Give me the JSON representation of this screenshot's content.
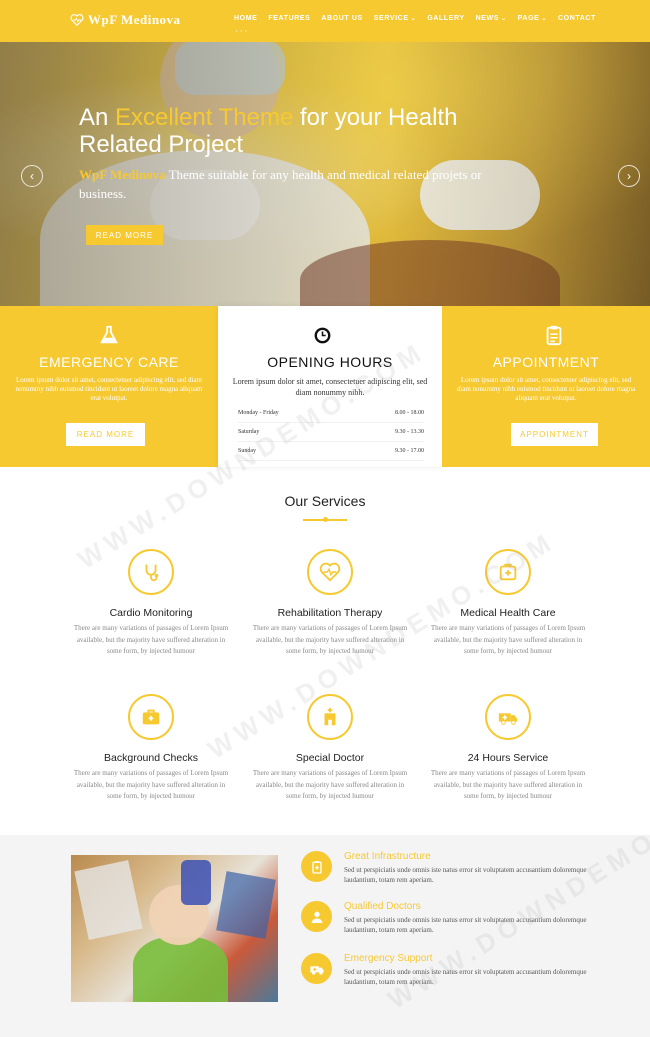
{
  "nav": {
    "logo": "WpF Medinova",
    "items": [
      {
        "label": "HOME",
        "has_caret": false,
        "active": true
      },
      {
        "label": "FEATURES",
        "has_caret": false,
        "active": false
      },
      {
        "label": "ABOUT US",
        "has_caret": false,
        "active": false
      },
      {
        "label": "SERVICE",
        "has_caret": true,
        "active": false
      },
      {
        "label": "GALLERY",
        "has_caret": false,
        "active": false
      },
      {
        "label": "NEWS",
        "has_caret": true,
        "active": false
      },
      {
        "label": "PAGE",
        "has_caret": true,
        "active": false
      },
      {
        "label": "CONTACT",
        "has_caret": false,
        "active": false
      }
    ]
  },
  "hero": {
    "title_1": "An ",
    "title_accent": "Excellent Theme",
    "title_2": " for your Health Related Project",
    "sub_brand": "WpF Medinova",
    "sub_text": " Theme suitable for any health and medical related projets or business.",
    "button": "READ MORE",
    "prev": "‹",
    "next": "›"
  },
  "info": {
    "emergency": {
      "title": "EMERGENCY CARE",
      "text": "Lorem ipsum dolor sit amet, consectetuer adipiscing elit, sed diam nonummy nibh euismod tincidunt ut laoreet dolore magna aliquam erat volutpat.",
      "button": "READ MORE"
    },
    "hours": {
      "title": "OPENING HOURS",
      "text": "Lorem ipsum dolor sit amet, consectetuer adipiscing elit, sed diam nonummy nibh.",
      "rows": [
        {
          "day": "Monday - Friday",
          "time": "8.00 - 18.00"
        },
        {
          "day": "Saturday",
          "time": "9.30 - 13.30"
        },
        {
          "day": "Sunday",
          "time": "9.30 - 17.00"
        }
      ]
    },
    "appointment": {
      "title": "APPOINTMENT",
      "text": "Lorem ipsum dolor sit amet, consectetuer adipiscing elit, sed diam nonummy nibh euismod tincidunt ut laoreet dolore magna aliquam erat volutpat.",
      "button": "APPOINTMENT"
    }
  },
  "services": {
    "title": "Our Services",
    "items": [
      {
        "name": "Cardio Monitoring",
        "icon": "stethoscope-icon",
        "text": "There are many variations of passages of Lorem Ipsum available, but the majority have suffered alteration in some form, by injected humour"
      },
      {
        "name": "Rehabilitation Therapy",
        "icon": "heart-pulse-icon",
        "text": "There are many variations of passages of Lorem Ipsum available, but the majority have suffered alteration in some form, by injected humour"
      },
      {
        "name": "Medical Health Care",
        "icon": "medical-kit-icon",
        "text": "There are many variations of passages of Lorem Ipsum available, but the majority have suffered alteration in some form, by injected humour"
      },
      {
        "name": "Background Checks",
        "icon": "briefcase-icon",
        "text": "There are many variations of passages of Lorem Ipsum available, but the majority have suffered alteration in some form, by injected humour"
      },
      {
        "name": "Special Doctor",
        "icon": "hospital-icon",
        "text": "There are many variations of passages of Lorem Ipsum available, but the majority have suffered alteration in some form, by injected humour"
      },
      {
        "name": "24 Hours Service",
        "icon": "ambulance-icon",
        "text": "There are many variations of passages of Lorem Ipsum available, but the majority have suffered alteration in some form, by injected humour"
      }
    ]
  },
  "features": [
    {
      "title": "Great Infrastructure",
      "icon": "clipboard-icon",
      "text": "Sed ut perspiciatis unde omnis iste natus error sit voluptatem accusantium doloremque laudantium, totam rem aperiam."
    },
    {
      "title": "Qualified Doctors",
      "icon": "doctor-icon",
      "text": "Sed ut perspiciatis unde omnis iste natus error sit voluptatem accusantium doloremque laudantium, totam rem aperiam."
    },
    {
      "title": "Emergency Support",
      "icon": "ambulance-icon",
      "text": "Sed ut perspiciatis unde omnis iste natus error sit voluptatem accusantium doloremque laudantium, totam rem aperiam."
    }
  ],
  "watermark": "WWW.DOWNDEMO.COM",
  "colors": {
    "accent": "#f7c931",
    "text": "#222222",
    "muted": "#888888",
    "features_bg": "#f4f4f4"
  }
}
